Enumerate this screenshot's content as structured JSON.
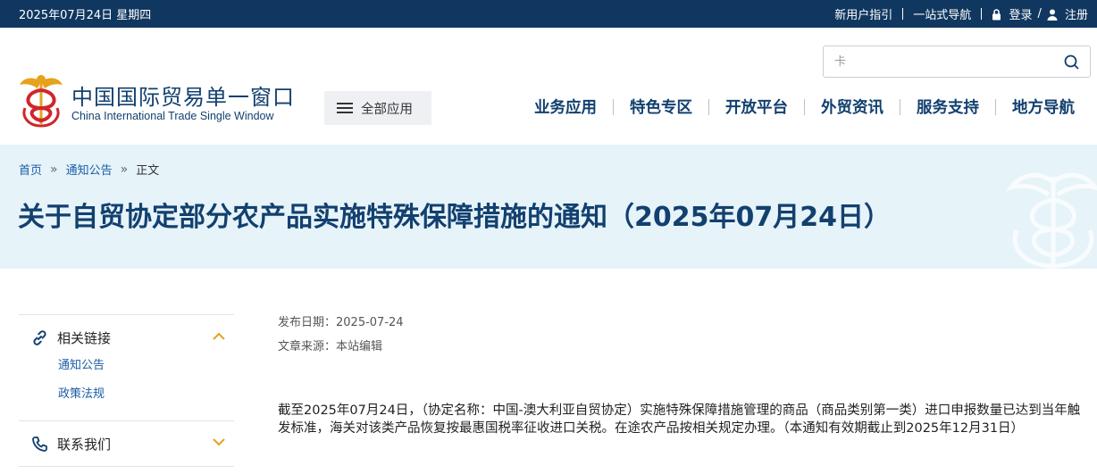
{
  "topbar": {
    "date": "2025年07月24日 星期四",
    "new_user_guide": "新用户指引",
    "one_stop_nav": "一站式导航",
    "login": "登录",
    "slash": "/",
    "register": "注册"
  },
  "header": {
    "brand_cn": "中国国际贸易单一窗口",
    "brand_en": "China International Trade Single Window",
    "all_apps": "全部应用",
    "search_placeholder": "卡",
    "nav": [
      "业务应用",
      "特色专区",
      "开放平台",
      "外贸资讯",
      "服务支持",
      "地方导航"
    ]
  },
  "breadcrumb": {
    "home": "首页",
    "notices": "通知公告",
    "current": "正文",
    "separator": "»"
  },
  "page_title": "关于自贸协定部分农产品实施特殊保障措施的通知（2025年07月24日）",
  "sidebar": {
    "related_links": {
      "title": "相关链接",
      "items": [
        "通知公告",
        "政策法规"
      ]
    },
    "contact": {
      "title": "联系我们"
    }
  },
  "article": {
    "publish_label": "发布日期：",
    "publish_date": "2025-07-24",
    "source_label": "文章来源：",
    "source": "本站编辑",
    "body": "截至2025年07月24日，（协定名称：中国-澳大利亚自贸协定）实施特殊保障措施管理的商品（商品类别第一类）进口申报数量已达到当年触发标准，海关对该类产品恢复按最惠国税率征收进口关税。在途农产品按相关规定办理。（本通知有效期截止到2025年12月31日）"
  },
  "colors": {
    "topbar_bg": "#10375f",
    "brand_blue": "#12406f",
    "link_blue": "#1a5da5",
    "banner_bg": "#e6f3f9",
    "accent_gold": "#e6a21c"
  }
}
